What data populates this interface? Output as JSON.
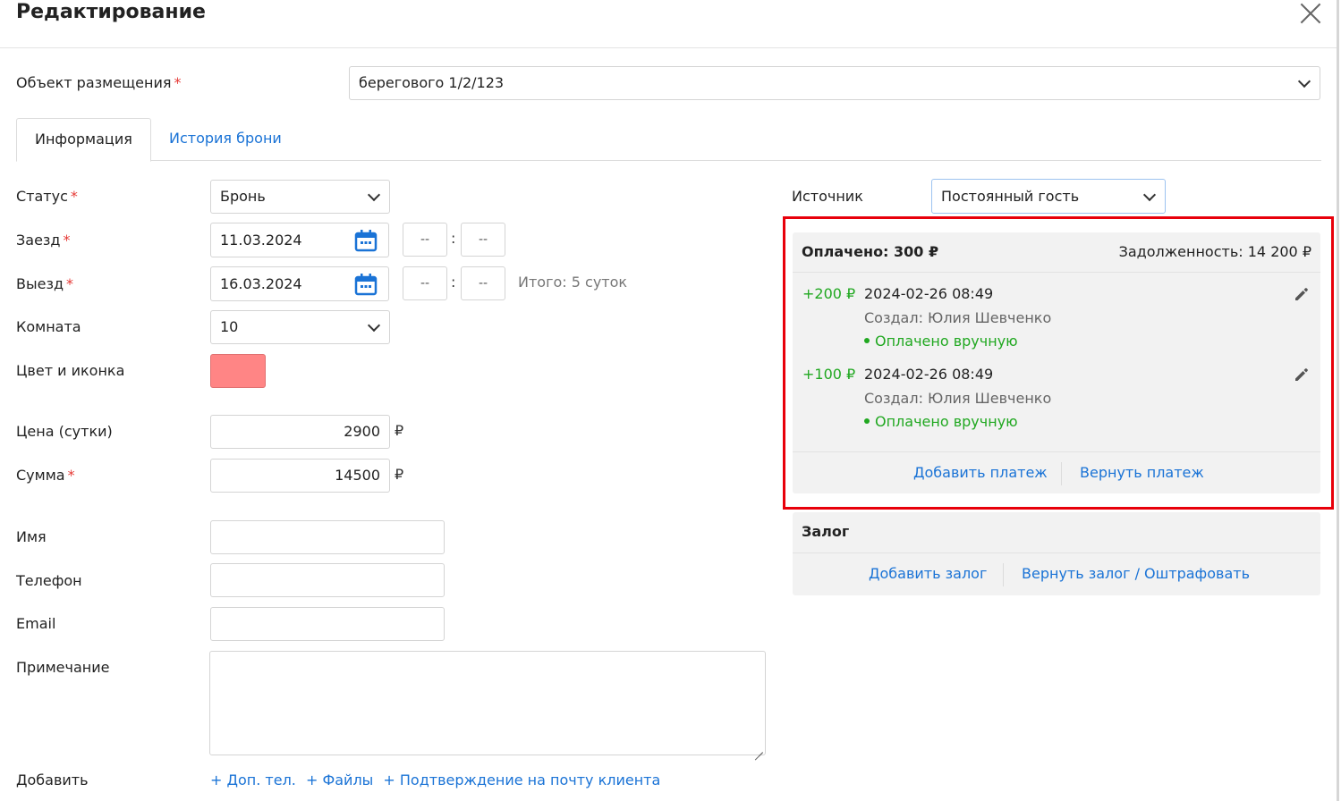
{
  "dialog": {
    "title": "Редактирование",
    "close_icon": "close-icon"
  },
  "object": {
    "label": "Объект размещения",
    "required_mark": "*",
    "value": "берегового 1/2/123"
  },
  "tabs": [
    {
      "label": "Информация",
      "active": true
    },
    {
      "label": "История брони",
      "active": false
    }
  ],
  "form": {
    "status": {
      "label": "Статус",
      "value": "Бронь"
    },
    "checkin": {
      "label": "Заезд",
      "date": "11.03.2024",
      "hour": "--",
      "minute": "--"
    },
    "checkout": {
      "label": "Выезд",
      "date": "16.03.2024",
      "hour": "--",
      "minute": "--"
    },
    "time_separator": ":",
    "total_nights": "Итого: 5 суток",
    "room": {
      "label": "Комната",
      "value": "10"
    },
    "color": {
      "label": "Цвет и иконка",
      "swatch": "#ff8585"
    },
    "price": {
      "label": "Цена (сутки)",
      "value": "2900"
    },
    "sum": {
      "label": "Сумма",
      "value": "14500"
    },
    "currency": "₽",
    "name": {
      "label": "Имя",
      "value": ""
    },
    "phone": {
      "label": "Телефон",
      "value": ""
    },
    "email": {
      "label": "Email",
      "value": ""
    },
    "note": {
      "label": "Примечание",
      "value": ""
    },
    "add": {
      "label": "Добавить",
      "links": [
        "+ Доп. тел.",
        "+ Файлы",
        "+ Подтверждение на почту клиента"
      ]
    },
    "source": {
      "label": "Источник",
      "value": "Постоянный гость"
    }
  },
  "payments": {
    "paid": "Оплачено: 300 ₽",
    "debt": "Задолженность: 14 200 ₽",
    "items": [
      {
        "amount": "+200 ₽",
        "date": "2024-02-26 08:49",
        "created_by": "Создал: Юлия Шевченко",
        "status": "Оплачено вручную"
      },
      {
        "amount": "+100 ₽",
        "date": "2024-02-26 08:49",
        "created_by": "Создал: Юлия Шевченко",
        "status": "Оплачено вручную"
      }
    ],
    "add_label": "Добавить платеж",
    "refund_label": "Вернуть платеж"
  },
  "deposit": {
    "title": "Залог",
    "add_label": "Добавить залог",
    "refund_label": "Вернуть залог / Оштрафовать"
  },
  "colors": {
    "accent": "#1a73d6",
    "success": "#21a821",
    "required": "#e53935",
    "highlight": "#e8000b"
  }
}
